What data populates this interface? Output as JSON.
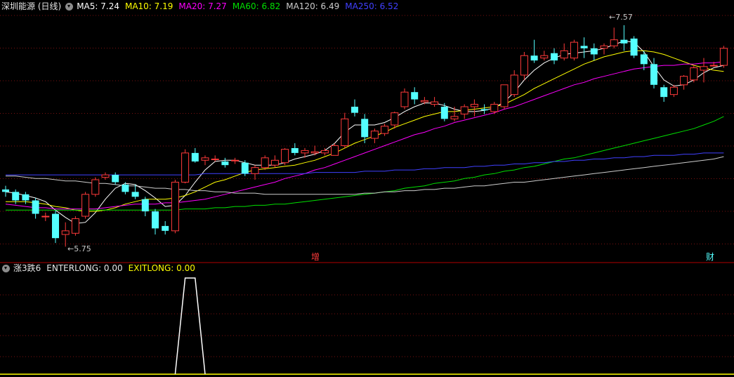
{
  "header": {
    "title": "深圳能源 (日线)",
    "ma": [
      {
        "label": "MA5: 7.24",
        "color": "#ffffff"
      },
      {
        "label": "MA10: 7.19",
        "color": "#ffff00"
      },
      {
        "label": "MA20: 7.27",
        "color": "#ff00ff"
      },
      {
        "label": "MA60: 6.82",
        "color": "#00e000"
      },
      {
        "label": "MA120: 6.49",
        "color": "#cccccc"
      },
      {
        "label": "MA250: 6.52",
        "color": "#4040ff"
      }
    ]
  },
  "indicator": {
    "name": "涨3跌6",
    "enter_label": "ENTERLONG: 0.00",
    "exit_label": "EXITLONG: 0.00"
  },
  "markers": {
    "zeng": "增",
    "cai": "财"
  },
  "annotations": {
    "low": "5.75",
    "high": "7.57"
  },
  "colors": {
    "up": "#ff3a3a",
    "down": "#54ffff",
    "grid": "#7a1010",
    "divider": "#b00000",
    "bg": "#000000"
  },
  "chart_data": {
    "type": "candlestick",
    "price_range": [
      5.7,
      7.65
    ],
    "candles": [
      [
        6.22,
        6.25,
        6.16,
        6.2
      ],
      [
        6.2,
        6.22,
        6.1,
        6.13
      ],
      [
        6.18,
        6.2,
        6.1,
        6.13
      ],
      [
        6.13,
        6.15,
        5.98,
        6.02
      ],
      [
        6.0,
        6.03,
        5.96,
        6.0
      ],
      [
        6.02,
        6.05,
        5.78,
        5.82
      ],
      [
        5.85,
        5.95,
        5.75,
        5.88
      ],
      [
        5.86,
        6.0,
        5.84,
        5.98
      ],
      [
        6.0,
        6.2,
        5.98,
        6.18
      ],
      [
        6.18,
        6.32,
        6.16,
        6.3
      ],
      [
        6.32,
        6.36,
        6.3,
        6.34
      ],
      [
        6.34,
        6.36,
        6.26,
        6.28
      ],
      [
        6.26,
        6.28,
        6.18,
        6.2
      ],
      [
        6.2,
        6.26,
        6.14,
        6.16
      ],
      [
        6.14,
        6.16,
        6.0,
        6.04
      ],
      [
        6.04,
        6.06,
        5.85,
        5.9
      ],
      [
        5.92,
        5.96,
        5.85,
        5.88
      ],
      [
        5.88,
        6.3,
        5.86,
        6.28
      ],
      [
        6.28,
        6.55,
        6.27,
        6.52
      ],
      [
        6.52,
        6.56,
        6.44,
        6.45
      ],
      [
        6.46,
        6.5,
        6.42,
        6.48
      ],
      [
        6.47,
        6.5,
        6.45,
        6.47
      ],
      [
        6.45,
        6.48,
        6.4,
        6.42
      ],
      [
        6.46,
        6.48,
        6.43,
        6.46
      ],
      [
        6.44,
        6.46,
        6.33,
        6.35
      ],
      [
        6.35,
        6.42,
        6.3,
        6.4
      ],
      [
        6.4,
        6.5,
        6.38,
        6.48
      ],
      [
        6.42,
        6.5,
        6.4,
        6.46
      ],
      [
        6.44,
        6.56,
        6.42,
        6.55
      ],
      [
        6.56,
        6.6,
        6.5,
        6.52
      ],
      [
        6.52,
        6.56,
        6.48,
        6.54
      ],
      [
        6.52,
        6.58,
        6.5,
        6.53
      ],
      [
        6.52,
        6.56,
        6.5,
        6.54
      ],
      [
        6.5,
        6.6,
        6.5,
        6.58
      ],
      [
        6.58,
        6.85,
        6.56,
        6.8
      ],
      [
        6.9,
        6.96,
        6.82,
        6.85
      ],
      [
        6.8,
        6.84,
        6.6,
        6.65
      ],
      [
        6.64,
        6.72,
        6.6,
        6.7
      ],
      [
        6.68,
        6.76,
        6.66,
        6.74
      ],
      [
        6.75,
        6.86,
        6.72,
        6.85
      ],
      [
        6.9,
        7.05,
        6.88,
        7.02
      ],
      [
        7.02,
        7.06,
        6.92,
        6.96
      ],
      [
        6.94,
        6.98,
        6.92,
        6.95
      ],
      [
        6.92,
        6.98,
        6.9,
        6.94
      ],
      [
        6.9,
        6.93,
        6.78,
        6.8
      ],
      [
        6.8,
        6.9,
        6.78,
        6.82
      ],
      [
        6.84,
        6.92,
        6.8,
        6.9
      ],
      [
        6.9,
        6.96,
        6.82,
        6.92
      ],
      [
        6.88,
        6.92,
        6.84,
        6.87
      ],
      [
        6.86,
        6.94,
        6.84,
        6.92
      ],
      [
        6.9,
        7.08,
        6.88,
        7.08
      ],
      [
        7.0,
        7.2,
        6.98,
        7.16
      ],
      [
        7.16,
        7.35,
        7.12,
        7.32
      ],
      [
        7.32,
        7.45,
        7.26,
        7.28
      ],
      [
        7.3,
        7.36,
        7.28,
        7.32
      ],
      [
        7.34,
        7.38,
        7.25,
        7.28
      ],
      [
        7.3,
        7.42,
        7.28,
        7.36
      ],
      [
        7.3,
        7.45,
        7.28,
        7.43
      ],
      [
        7.4,
        7.47,
        7.3,
        7.38
      ],
      [
        7.38,
        7.42,
        7.28,
        7.33
      ],
      [
        7.38,
        7.42,
        7.33,
        7.4
      ],
      [
        7.4,
        7.55,
        7.38,
        7.45
      ],
      [
        7.45,
        7.57,
        7.36,
        7.42
      ],
      [
        7.46,
        7.48,
        7.3,
        7.32
      ],
      [
        7.33,
        7.36,
        7.2,
        7.25
      ],
      [
        7.25,
        7.3,
        7.05,
        7.08
      ],
      [
        7.06,
        7.08,
        6.94,
        6.98
      ],
      [
        7.0,
        7.08,
        6.98,
        7.06
      ],
      [
        7.08,
        7.16,
        7.04,
        7.15
      ],
      [
        7.12,
        7.24,
        7.1,
        7.22
      ],
      [
        7.2,
        7.3,
        7.1,
        7.23
      ],
      [
        7.24,
        7.27,
        7.23,
        7.24
      ],
      [
        7.24,
        7.4,
        7.22,
        7.38
      ]
    ],
    "ma_series": [
      {
        "name": "MA5",
        "color": "#ffffff",
        "values": [
          6.2,
          6.19,
          6.17,
          6.15,
          6.12,
          6.05,
          5.99,
          5.94,
          5.95,
          6.03,
          6.14,
          6.23,
          6.27,
          6.26,
          6.21,
          6.15,
          6.08,
          6.09,
          6.17,
          6.28,
          6.38,
          6.45,
          6.46,
          6.46,
          6.44,
          6.42,
          6.42,
          6.42,
          6.44,
          6.47,
          6.49,
          6.51,
          6.54,
          6.6,
          6.69,
          6.75,
          6.75,
          6.75,
          6.77,
          6.81,
          6.86,
          6.9,
          6.93,
          6.93,
          6.91,
          6.88,
          6.86,
          6.86,
          6.87,
          6.89,
          6.94,
          7.02,
          7.12,
          7.2,
          7.26,
          7.3,
          7.33,
          7.34,
          7.35,
          7.36,
          7.38,
          7.41,
          7.44,
          7.43,
          7.35,
          7.23,
          7.12,
          7.07,
          7.08,
          7.12,
          7.18,
          7.22,
          7.24
        ]
      },
      {
        "name": "MA10",
        "color": "#ffff00",
        "values": [
          6.12,
          6.12,
          6.12,
          6.11,
          6.1,
          6.08,
          6.07,
          6.05,
          6.04,
          6.04,
          6.05,
          6.07,
          6.1,
          6.12,
          6.14,
          6.14,
          6.14,
          6.15,
          6.17,
          6.2,
          6.24,
          6.28,
          6.3,
          6.33,
          6.36,
          6.38,
          6.39,
          6.4,
          6.41,
          6.42,
          6.44,
          6.46,
          6.49,
          6.52,
          6.56,
          6.6,
          6.63,
          6.66,
          6.69,
          6.73,
          6.76,
          6.79,
          6.82,
          6.84,
          6.86,
          6.86,
          6.87,
          6.88,
          6.89,
          6.9,
          6.92,
          6.96,
          7.0,
          7.05,
          7.09,
          7.13,
          7.17,
          7.21,
          7.25,
          7.28,
          7.31,
          7.33,
          7.35,
          7.36,
          7.36,
          7.35,
          7.33,
          7.3,
          7.27,
          7.24,
          7.22,
          7.2,
          7.19
        ]
      },
      {
        "name": "MA20",
        "color": "#ff00ff",
        "values": [
          6.1,
          6.09,
          6.08,
          6.07,
          6.07,
          6.06,
          6.06,
          6.06,
          6.06,
          6.06,
          6.07,
          6.08,
          6.09,
          6.1,
          6.1,
          6.1,
          6.11,
          6.11,
          6.12,
          6.13,
          6.14,
          6.16,
          6.18,
          6.2,
          6.22,
          6.24,
          6.26,
          6.28,
          6.31,
          6.33,
          6.35,
          6.38,
          6.4,
          6.43,
          6.46,
          6.49,
          6.52,
          6.55,
          6.58,
          6.61,
          6.64,
          6.67,
          6.69,
          6.72,
          6.74,
          6.77,
          6.79,
          6.81,
          6.83,
          6.85,
          6.88,
          6.9,
          6.93,
          6.96,
          6.99,
          7.02,
          7.05,
          7.08,
          7.1,
          7.13,
          7.15,
          7.17,
          7.19,
          7.21,
          7.22,
          7.23,
          7.24,
          7.24,
          7.25,
          7.25,
          7.26,
          7.26,
          7.27
        ]
      },
      {
        "name": "MA60",
        "color": "#00e000",
        "values": [
          6.05,
          6.05,
          6.05,
          6.05,
          6.05,
          6.05,
          6.05,
          6.05,
          6.05,
          6.05,
          6.05,
          6.05,
          6.05,
          6.05,
          6.05,
          6.05,
          6.05,
          6.05,
          6.06,
          6.06,
          6.06,
          6.07,
          6.07,
          6.08,
          6.08,
          6.09,
          6.09,
          6.1,
          6.1,
          6.11,
          6.12,
          6.13,
          6.14,
          6.15,
          6.16,
          6.17,
          6.18,
          6.19,
          6.2,
          6.21,
          6.23,
          6.24,
          6.25,
          6.27,
          6.28,
          6.29,
          6.31,
          6.32,
          6.34,
          6.35,
          6.37,
          6.38,
          6.4,
          6.41,
          6.43,
          6.45,
          6.47,
          6.48,
          6.5,
          6.52,
          6.54,
          6.56,
          6.58,
          6.6,
          6.62,
          6.64,
          6.66,
          6.68,
          6.7,
          6.72,
          6.75,
          6.78,
          6.82
        ]
      },
      {
        "name": "MA120",
        "color": "#cccccc",
        "values": [
          6.33,
          6.33,
          6.32,
          6.31,
          6.31,
          6.3,
          6.29,
          6.29,
          6.28,
          6.27,
          6.27,
          6.26,
          6.25,
          6.25,
          6.24,
          6.23,
          6.23,
          6.22,
          6.22,
          6.21,
          6.21,
          6.2,
          6.2,
          6.19,
          6.19,
          6.19,
          6.18,
          6.18,
          6.18,
          6.18,
          6.18,
          6.18,
          6.18,
          6.18,
          6.18,
          6.18,
          6.19,
          6.19,
          6.2,
          6.2,
          6.21,
          6.21,
          6.22,
          6.22,
          6.23,
          6.23,
          6.24,
          6.25,
          6.25,
          6.26,
          6.27,
          6.28,
          6.28,
          6.29,
          6.3,
          6.31,
          6.32,
          6.33,
          6.34,
          6.35,
          6.36,
          6.37,
          6.38,
          6.39,
          6.4,
          6.41,
          6.42,
          6.43,
          6.44,
          6.45,
          6.46,
          6.47,
          6.49
        ]
      },
      {
        "name": "MA250",
        "color": "#4040ff",
        "values": [
          6.34,
          6.34,
          6.34,
          6.34,
          6.34,
          6.34,
          6.34,
          6.34,
          6.34,
          6.34,
          6.34,
          6.34,
          6.34,
          6.34,
          6.34,
          6.34,
          6.34,
          6.34,
          6.34,
          6.34,
          6.35,
          6.35,
          6.35,
          6.35,
          6.35,
          6.35,
          6.35,
          6.35,
          6.35,
          6.35,
          6.35,
          6.36,
          6.36,
          6.36,
          6.36,
          6.36,
          6.37,
          6.37,
          6.37,
          6.38,
          6.38,
          6.38,
          6.39,
          6.39,
          6.4,
          6.4,
          6.4,
          6.41,
          6.41,
          6.42,
          6.42,
          6.43,
          6.43,
          6.44,
          6.44,
          6.45,
          6.45,
          6.46,
          6.46,
          6.47,
          6.47,
          6.48,
          6.48,
          6.49,
          6.49,
          6.5,
          6.5,
          6.5,
          6.51,
          6.51,
          6.52,
          6.52,
          6.52
        ]
      }
    ],
    "indicator_series": {
      "name": "EXITLONG",
      "color": "#ffffff",
      "baseline_color": "#ffff00",
      "values": [
        0,
        0,
        0,
        0,
        0,
        0,
        0,
        0,
        0,
        0,
        0,
        0,
        0,
        0,
        0,
        0,
        0,
        0,
        1,
        1,
        0,
        0,
        0,
        0,
        0,
        0,
        0,
        0,
        0,
        0,
        0,
        0,
        0,
        0,
        0,
        0,
        0,
        0,
        0,
        0,
        0,
        0,
        0,
        0,
        0,
        0,
        0,
        0,
        0,
        0,
        0,
        0,
        0,
        0,
        0,
        0,
        0,
        0,
        0,
        0,
        0,
        0,
        0,
        0,
        0,
        0,
        0,
        0,
        0,
        0,
        0,
        0,
        0
      ]
    }
  }
}
